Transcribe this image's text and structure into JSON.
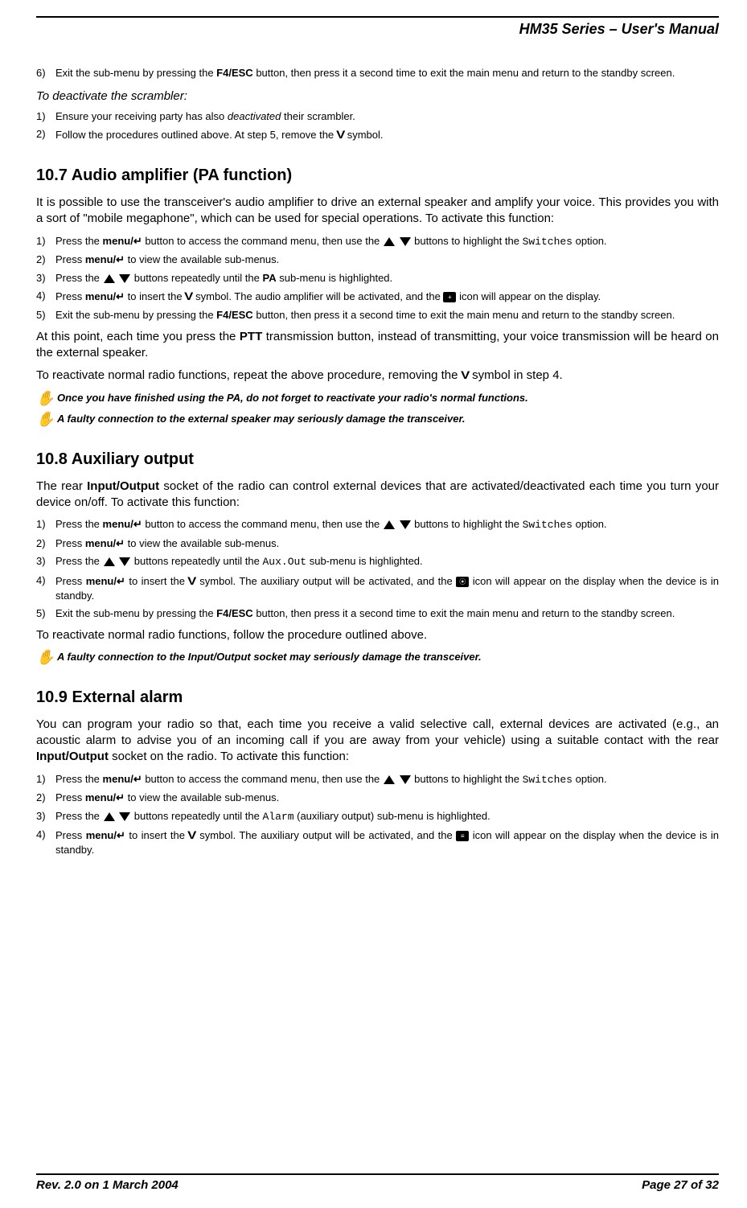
{
  "header": {
    "title": "HM35 Series – User's Manual"
  },
  "section_pre": {
    "step6": "Exit the sub-menu by pressing the ",
    "step6_btn": "F4/ESC",
    "step6_after": " button, then press it a second time to exit the main menu and return to the standby screen.",
    "deact_title": "To deactivate the scrambler",
    "deact_step1_a": "Ensure your receiving party has also ",
    "deact_step1_i": "deactivated",
    "deact_step1_b": " their scrambler.",
    "deact_step2_a": "Follow the procedures outlined above.  At step 5, remove the ",
    "deact_step2_b": " symbol."
  },
  "s107": {
    "heading": "10.7  Audio amplifier (PA function)",
    "intro": "It is possible to use the transceiver's audio amplifier to drive an external speaker and amplify your voice.  This provides you with a sort of \"mobile megaphone\", which can be used for special operations.  To activate this function:",
    "step1_a": "Press the ",
    "menu_btn": "menu/↵",
    "step1_b": " button to access the command menu, then use the ",
    "step1_c": " buttons to highlight the ",
    "switches": "Switches",
    "step1_d": " option.",
    "step2_a": "Press ",
    "step2_b": " to view the available sub-menus.",
    "step3_a": "Press the ",
    "step3_b": " buttons repeatedly until the ",
    "pa": "PA",
    "step3_c": " sub-menu is highlighted.",
    "step4_a": "Press ",
    "step4_b": " to insert the ",
    "step4_c": " symbol.  The audio amplifier will be activated, and the ",
    "step4_d": " icon will appear on the display.",
    "step5_a": "Exit the sub-menu by pressing the ",
    "f4esc": "F4/ESC",
    "step5_b": " button, then press it a second time to exit the main menu and return to the standby screen.",
    "after1_a": "At this point, each time you press the ",
    "ptt": "PTT",
    "after1_b": " transmission button, instead of transmitting, your voice transmission will be heard on the external speaker.",
    "after2_a": "To reactivate normal radio functions, repeat the above procedure, removing the ",
    "after2_b": " symbol in step 4.",
    "note1": "Once you have finished using the PA, do not forget to reactivate your radio's normal functions.",
    "note2": "A faulty connection to the external speaker may seriously damage the transceiver."
  },
  "s108": {
    "heading": "10.8  Auxiliary output",
    "intro_a": "The rear ",
    "io": "Input/Output",
    "intro_b": " socket of the radio can control external devices that are activated/deactivated each time you turn your device on/off.  To activate this function:",
    "step1_a": "Press the ",
    "step1_b": " button to access the command menu, then use the ",
    "step1_c": " buttons to highlight the ",
    "step1_d": " option.",
    "step2_a": "Press ",
    "step2_b": " to view the available sub-menus.",
    "step3_a": "Press the ",
    "step3_b": " buttons repeatedly until the ",
    "auxout": "Aux.Out",
    "step3_c": "  sub-menu is highlighted.",
    "step4_a": "Press ",
    "step4_b": " to insert the ",
    "step4_c": " symbol.  The auxiliary output will be activated, and the ",
    "step4_d": " icon will appear on the display when the device is in standby.",
    "step5_a": "Exit the sub-menu by pressing the ",
    "step5_b": " button, then press it a second time to exit the main menu and return to the standby screen.",
    "after": "To reactivate normal radio functions, follow the procedure outlined above.",
    "note": "A faulty connection to the Input/Output socket may seriously damage the transceiver."
  },
  "s109": {
    "heading": "10.9  External alarm",
    "intro_a": "You can program your radio so that, each time you receive a valid selective call, external devices are activated (e.g., an acoustic alarm to advise you of an incoming call if you are away from your vehicle) using a suitable contact with the rear ",
    "io": "Input/Output",
    "intro_b": " socket on the radio.  To activate this function:",
    "step1_a": "Press the ",
    "step1_b": " button to access the command menu, then use the ",
    "step1_c": " buttons to highlight the ",
    "step1_d": " option.",
    "step2_a": "Press ",
    "step2_b": " to view the available sub-menus.",
    "step3_a": "Press the ",
    "step3_b": " buttons repeatedly until the ",
    "alarm": "Alarm",
    "step3_c": "  (auxiliary output) sub-menu is highlighted.",
    "step4_a": "Press ",
    "step4_b": " to insert the ",
    "step4_c": " symbol.  The auxiliary output will be activated, and the ",
    "step4_d": " icon will appear on the display when the device is in standby."
  },
  "footer": {
    "rev": "Rev. 2.0 on 1 March 2004",
    "page": "Page 27 of 32"
  },
  "glyphs": {
    "hand": "✋",
    "check_v": "V"
  },
  "nums": {
    "n1": "1)",
    "n2": "2)",
    "n3": "3)",
    "n4": "4)",
    "n5": "5)",
    "n6": "6)"
  }
}
